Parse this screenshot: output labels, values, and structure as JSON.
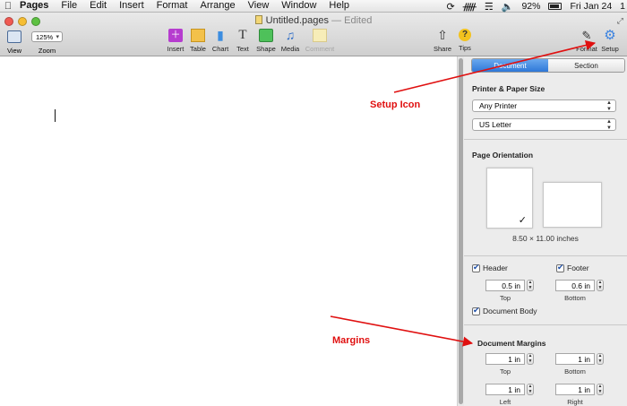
{
  "menubar": {
    "app": "Pages",
    "items": [
      "File",
      "Edit",
      "Insert",
      "Format",
      "Arrange",
      "View",
      "Window",
      "Help"
    ],
    "battery": "92%",
    "clock": "Fri Jan 24",
    "user_menu": "1"
  },
  "window": {
    "title": "Untitled.pages",
    "status": "— Edited"
  },
  "toolbar": {
    "view": "View",
    "zoom_value": "125%",
    "zoom_label": "Zoom",
    "insert": "Insert",
    "table": "Table",
    "chart": "Chart",
    "text": "Text",
    "shape": "Shape",
    "media": "Media",
    "comment": "Comment",
    "share": "Share",
    "tips": "Tips",
    "format": "Format",
    "setup": "Setup"
  },
  "inspector": {
    "tabs": [
      "Document",
      "Section"
    ],
    "active_tab": "Document",
    "printer_section": "Printer & Paper Size",
    "printer": "Any Printer",
    "paper": "US Letter",
    "orientation_section": "Page Orientation",
    "page_size": "8.50 × 11.00 inches",
    "header_label": "Header",
    "footer_label": "Footer",
    "header_value": "0.5 in",
    "footer_value": "0.6 in",
    "header_sub": "Top",
    "footer_sub": "Bottom",
    "body_label": "Document Body",
    "margins_section": "Document Margins",
    "margin_top": "1 in",
    "margin_bottom": "1 in",
    "margin_left": "1 in",
    "margin_right": "1 in",
    "top_label": "Top",
    "bottom_label": "Bottom",
    "left_label": "Left",
    "right_label": "Right"
  },
  "annotations": {
    "setup": "Setup Icon",
    "margins": "Margins"
  },
  "colors": {
    "accent": "#3a82e0",
    "annotation": "#e01010"
  }
}
